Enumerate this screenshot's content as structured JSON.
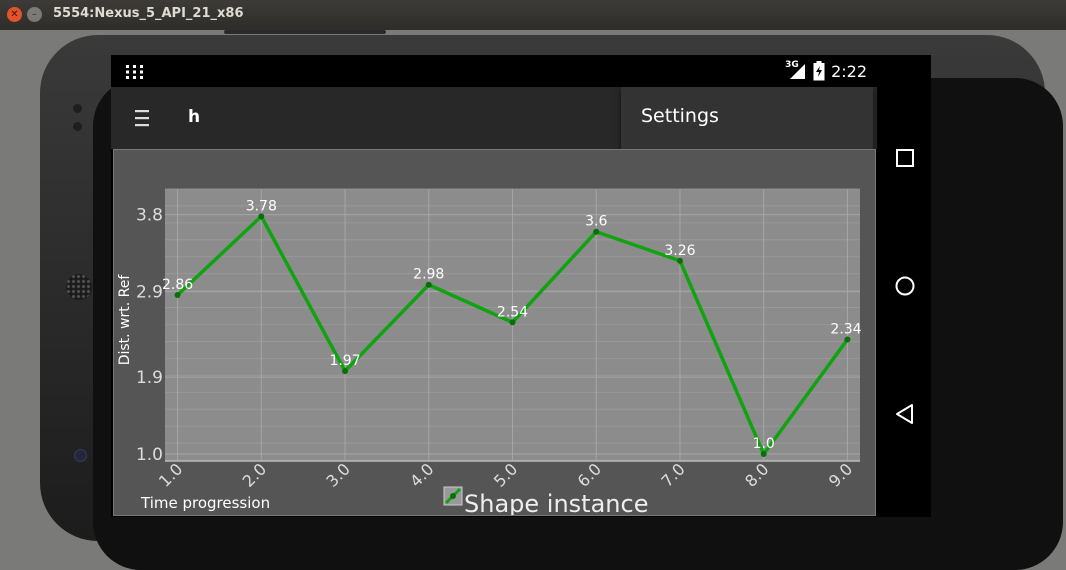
{
  "window": {
    "title": "5554:Nexus_5_API_21_x86"
  },
  "status_bar": {
    "network": "3G",
    "time": "2:22"
  },
  "toolbar": {
    "title": "h"
  },
  "menu": {
    "items": [
      "Settings"
    ]
  },
  "chart_data": {
    "type": "line",
    "x": [
      1.0,
      2.0,
      3.0,
      4.0,
      5.0,
      6.0,
      7.0,
      8.0,
      9.0
    ],
    "x_tick_labels": [
      "1.0",
      "2.0",
      "3.0",
      "4.0",
      "5.0",
      "6.0",
      "7.0",
      "8.0",
      "9.0"
    ],
    "series": [
      {
        "name": "Shape instance",
        "values": [
          2.86,
          3.78,
          1.97,
          2.98,
          2.54,
          3.6,
          3.26,
          1.0,
          2.34
        ],
        "point_labels": [
          "2.86",
          "3.78",
          "1.97",
          "2.98",
          "2.54",
          "3.6",
          "3.26",
          "1.0",
          "2.34"
        ]
      }
    ],
    "y_ticks": [
      1.0,
      1.9,
      2.9,
      3.8
    ],
    "y_tick_labels": [
      "1.0",
      "1.9",
      "2.9",
      "3.8"
    ],
    "xlabel": "Time progression",
    "ylabel": "Dist. wrt. Ref",
    "xlim": [
      0.85,
      9.15
    ],
    "ylim": [
      0.93,
      4.1
    ],
    "grid": true,
    "legend": "bottom",
    "colors": {
      "line": "#0fa30f",
      "plot_bg": "#8c8c8c",
      "panel_bg": "#555555",
      "grid": "#a6a6a6",
      "text": "#ffffff",
      "axis_text": "#dddddd"
    }
  }
}
